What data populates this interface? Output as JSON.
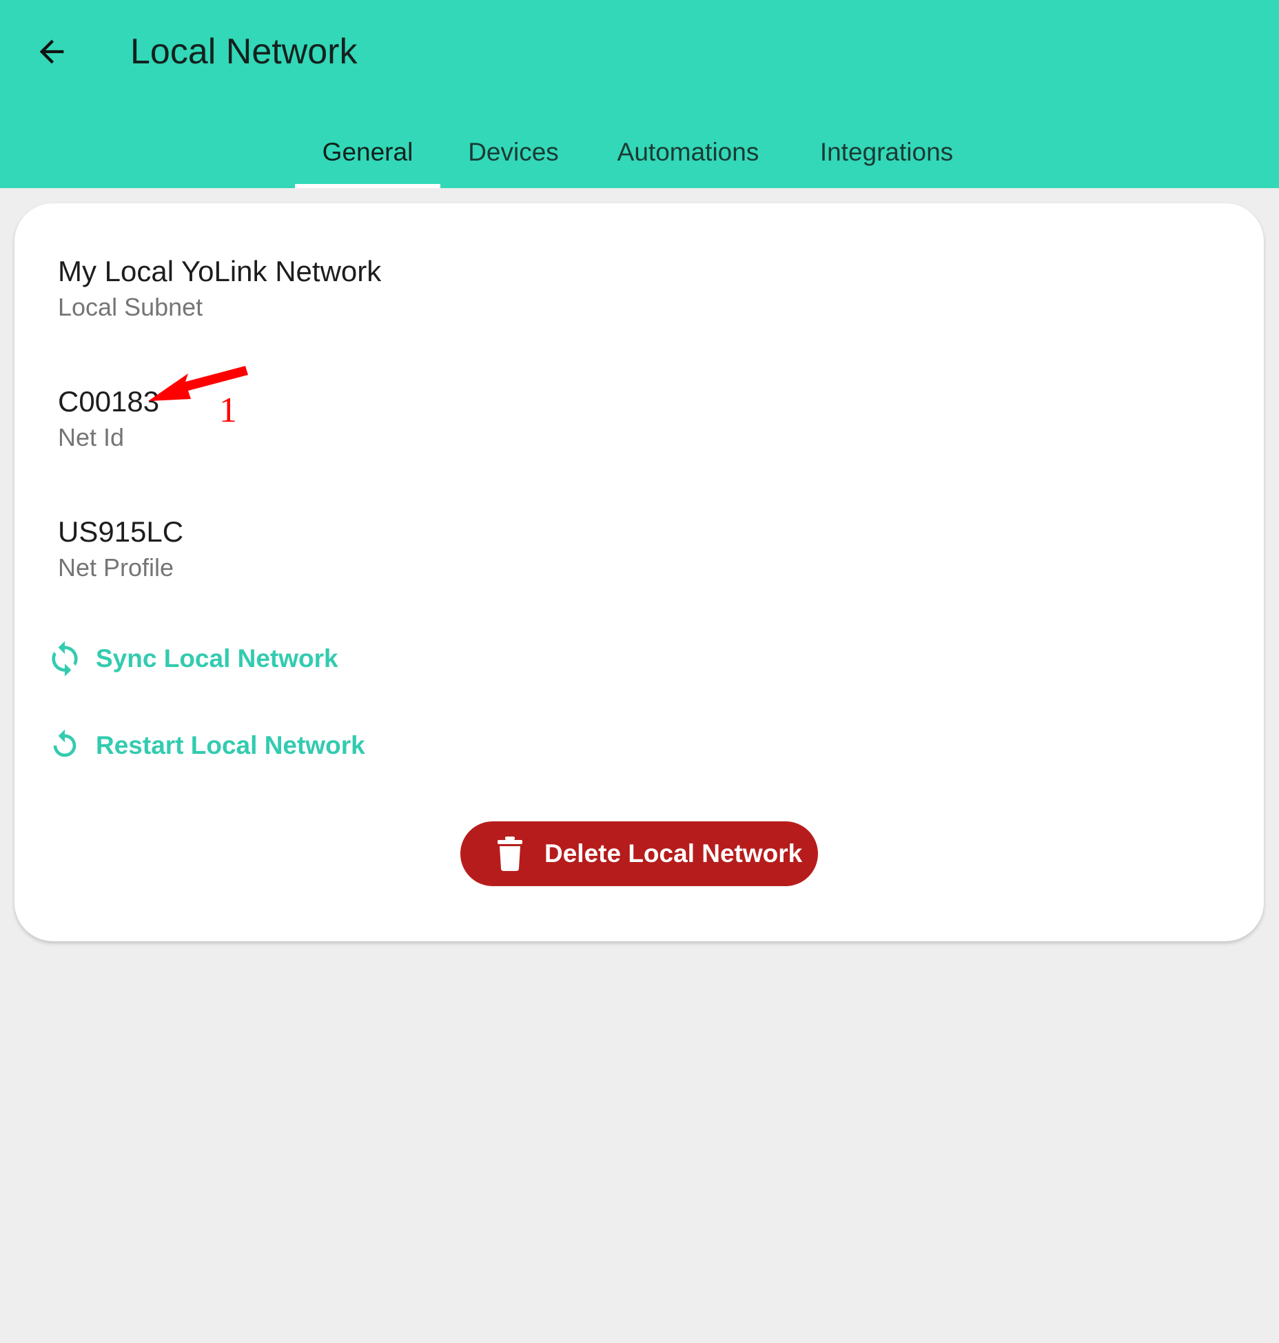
{
  "header": {
    "title": "Local Network",
    "back_icon": "arrow-left-icon",
    "background_color": "#32d8b7"
  },
  "tabs": [
    {
      "label": "General",
      "active": true
    },
    {
      "label": "Devices",
      "active": false
    },
    {
      "label": "Automations",
      "active": false
    },
    {
      "label": "Integrations",
      "active": false
    }
  ],
  "card": {
    "fields": [
      {
        "value": "My Local YoLink Network",
        "label": "Local Subnet"
      },
      {
        "value": "C00183",
        "label": "Net Id"
      },
      {
        "value": "US915LC",
        "label": "Net Profile"
      }
    ],
    "actions": [
      {
        "label": "Sync Local Network",
        "icon": "sync-icon"
      },
      {
        "label": "Restart Local Network",
        "icon": "restart-icon"
      }
    ],
    "delete_button": {
      "label": "Delete Local Network",
      "icon": "trash-icon",
      "color": "#b71c1c"
    },
    "accent_color": "#33cbb0"
  },
  "annotation": {
    "number": "1",
    "color": "#ff0000"
  }
}
